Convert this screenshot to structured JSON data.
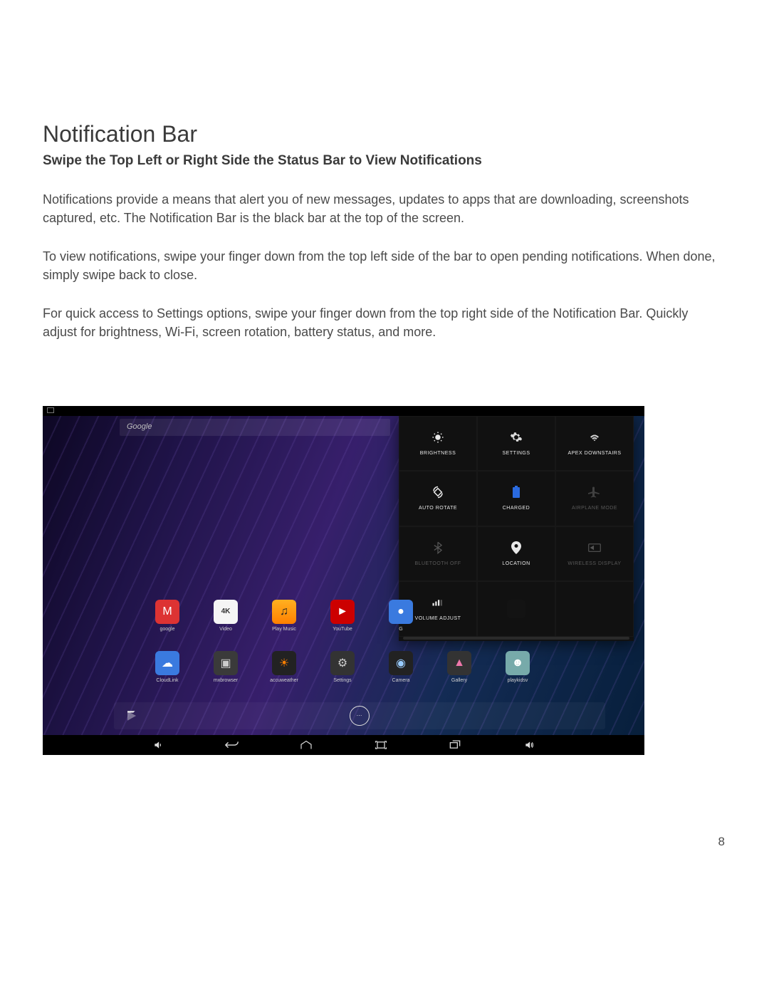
{
  "doc": {
    "heading": "Notification Bar",
    "subheading": "Swipe the Top Left or Right Side the Status Bar to View Notifications",
    "p1": "Notifications provide a means that alert you of new messages, updates to apps that are downloading, screenshots captured, etc. The Notification Bar is the black bar at the top of the screen.",
    "p2": "To view notifications, swipe your finger down from the top left side of the bar to open pending notifications. When done, simply swipe back to close.",
    "p3": "For quick access to Settings options, swipe your finger down from the top right side of the Notification Bar. Quickly adjust for brightness, Wi-Fi, screen rotation, battery status, and more.",
    "page_number": "8"
  },
  "screenshot": {
    "search_placeholder": "Google",
    "quick_settings": [
      {
        "label": "BRIGHTNESS",
        "icon": "brightness",
        "dim": false
      },
      {
        "label": "SETTINGS",
        "icon": "settings",
        "dim": false
      },
      {
        "label": "APEX DOWNSTAIRS",
        "icon": "wifi",
        "dim": false
      },
      {
        "label": "AUTO ROTATE",
        "icon": "rotate",
        "dim": false
      },
      {
        "label": "CHARGED",
        "icon": "battery",
        "dim": false
      },
      {
        "label": "AIRPLANE MODE",
        "icon": "airplane",
        "dim": true
      },
      {
        "label": "BLUETOOTH OFF",
        "icon": "bluetooth",
        "dim": true
      },
      {
        "label": "LOCATION",
        "icon": "location",
        "dim": false
      },
      {
        "label": "WIRELESS DISPLAY",
        "icon": "cast",
        "dim": true
      },
      {
        "label": "VOLUME ADJUST",
        "icon": "volume",
        "dim": false
      }
    ],
    "apps_row1": [
      {
        "label": "google",
        "glyph": "M",
        "cls": "bg-red"
      },
      {
        "label": "Video",
        "glyph": "4K",
        "cls": "bg-white"
      },
      {
        "label": "Play Music",
        "glyph": "♫",
        "cls": "bg-orange"
      },
      {
        "label": "YouTube",
        "glyph": "►",
        "cls": "bg-yred"
      },
      {
        "label": "G",
        "glyph": "●",
        "cls": "bg-blue"
      }
    ],
    "apps_row2": [
      {
        "label": "CloudLink",
        "glyph": "☁",
        "cls": "bg-blue"
      },
      {
        "label": "mxbrowser",
        "glyph": "▣",
        "cls": "bg-grey"
      },
      {
        "label": "accuweather",
        "glyph": "☀",
        "cls": "bg-sun"
      },
      {
        "label": "Settings",
        "glyph": "⚙",
        "cls": "bg-gear"
      },
      {
        "label": "Camera",
        "glyph": "◉",
        "cls": "bg-cam"
      },
      {
        "label": "Gallery",
        "glyph": "▲",
        "cls": "bg-gal"
      },
      {
        "label": "playkidsv",
        "glyph": "☻",
        "cls": "bg-pk"
      }
    ],
    "qs_hidden_tile_label": "",
    "dock_center_glyph": "⋮⋮⋮"
  }
}
